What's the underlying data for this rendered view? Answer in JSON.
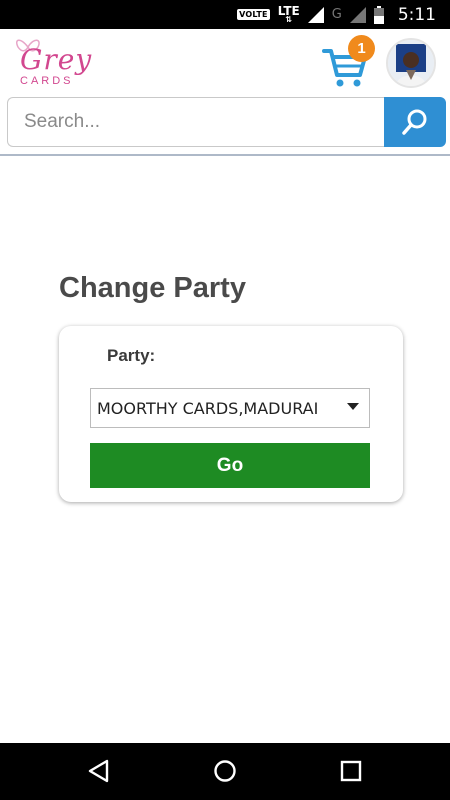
{
  "status_bar": {
    "volte": "VOLTE",
    "network": "LTE",
    "network2": "G",
    "time": "5:11"
  },
  "header": {
    "logo_text": "Grey",
    "logo_sub": "CARDS",
    "cart_count": "1"
  },
  "search": {
    "placeholder": "Search..."
  },
  "main": {
    "title": "Change Party",
    "party_label": "Party:",
    "party_selected": "MOORTHY CARDS,MADURAI",
    "go_label": "Go"
  },
  "colors": {
    "brand_pink": "#d2478f",
    "search_blue": "#2f8fd3",
    "go_green": "#1e8b23",
    "badge_orange": "#f08a1c"
  },
  "icons": [
    "signal-icon",
    "battery-icon",
    "cart-icon",
    "search-icon",
    "back-icon",
    "home-icon",
    "recents-icon"
  ]
}
